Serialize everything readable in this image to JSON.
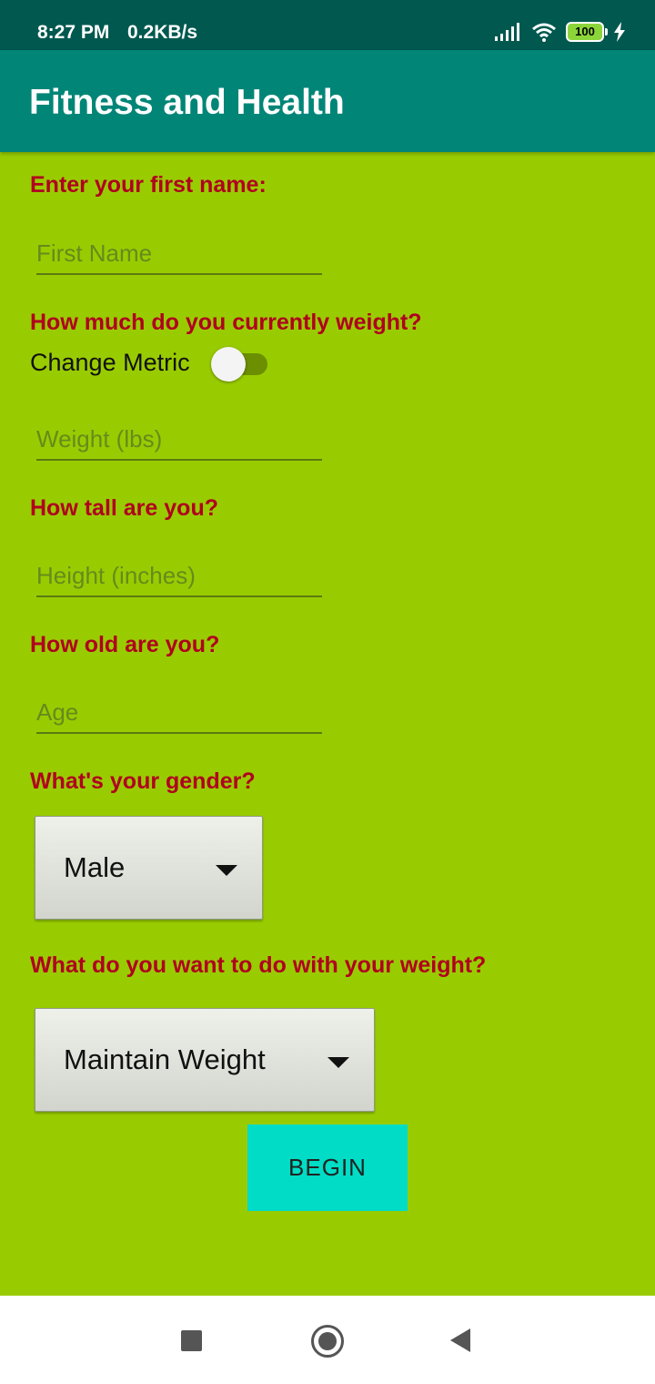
{
  "status_bar": {
    "time": "8:27 PM",
    "net_speed": "0.2KB/s",
    "battery": "100",
    "icons": [
      "signal-icon",
      "wifi-icon",
      "battery-icon",
      "charging-icon"
    ]
  },
  "app_bar": {
    "title": "Fitness and Health",
    "color": "#008577"
  },
  "form": {
    "background": "#99cc00",
    "label_color": "#b00020",
    "name_label": "Enter your first name:",
    "name_placeholder": "First Name",
    "weight_label": "How much do you currently weight?",
    "metric_toggle_label": "Change Metric",
    "metric_toggle_on": false,
    "weight_placeholder": "Weight (lbs)",
    "height_label": "How tall are you?",
    "height_placeholder": "Height (inches)",
    "age_label": "How old are you?",
    "age_placeholder": "Age",
    "gender_label": "What's your gender?",
    "gender_value": "Male",
    "goal_label": "What do you want to do with your weight?",
    "goal_value": "Maintain Weight",
    "begin_label": "BEGIN",
    "begin_color": "#00dcc5"
  },
  "nav_bar": {
    "icons": [
      "recents-icon",
      "home-icon",
      "back-icon"
    ]
  }
}
